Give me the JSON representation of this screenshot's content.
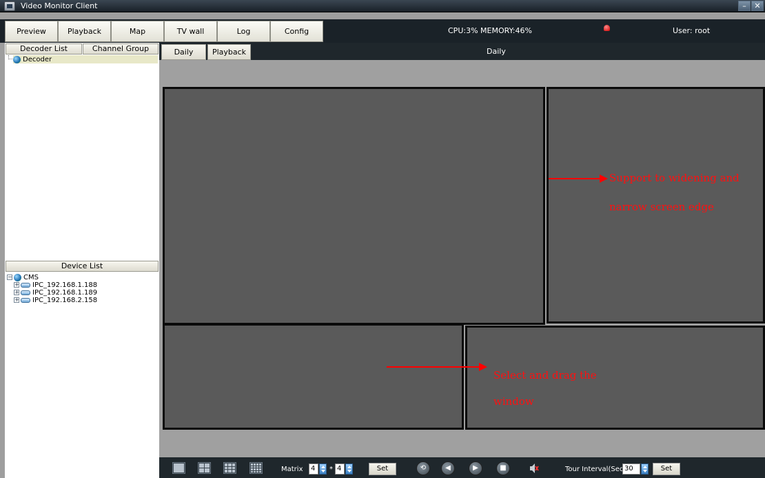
{
  "window": {
    "title": "Video Monitor Client",
    "minimize_glyph": "–",
    "close_glyph": "✕"
  },
  "menu": {
    "items": [
      "Preview",
      "Playback",
      "Map",
      "TV wall",
      "Log",
      "Config"
    ],
    "cpu_memory": "CPU:3%  MEMORY:46%",
    "user": "User: root"
  },
  "left_panel": {
    "tabs": [
      "Decoder List",
      "Channel Group"
    ],
    "decoder_tree": [
      "Decoder"
    ],
    "device_list_title": "Device List",
    "device_root": "CMS",
    "devices": [
      "IPC_192.168.1.188",
      "IPC_192.168.1.189",
      "IPC_192.168.2.158"
    ]
  },
  "main": {
    "tabs": [
      "Daily",
      "Playback"
    ],
    "current_view_title": "Daily"
  },
  "annotations": {
    "widen": [
      "Support  to  widening  and",
      "narrow screen edge"
    ],
    "drag": [
      "Select     and     drag     the",
      "window"
    ]
  },
  "toolbar": {
    "matrix_label": "Matrix",
    "matrix_rows": "4",
    "matrix_sep": "*",
    "matrix_cols": "4",
    "set_label": "Set",
    "tour_label": "Tour Interval(Sec)",
    "tour_value": "30",
    "tour_set_label": "Set"
  },
  "colors": {
    "accent": "#ff0000",
    "panel_fill": "#5a5a5a",
    "dark_bar": "#1f272c"
  }
}
